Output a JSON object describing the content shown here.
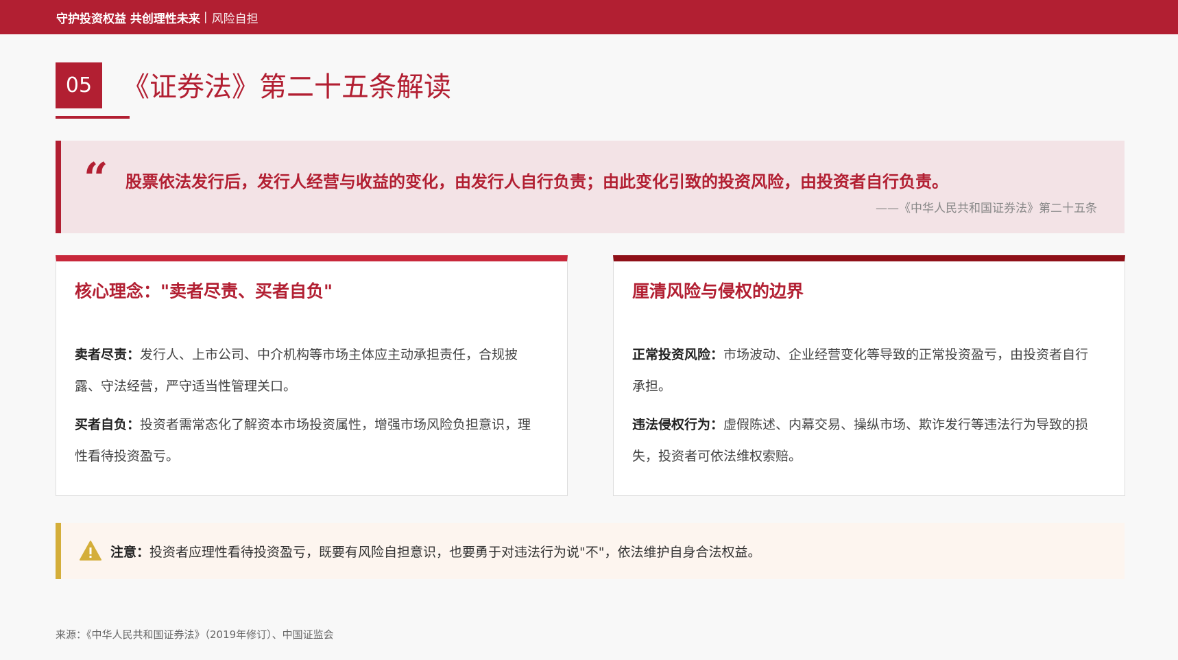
{
  "header": {
    "title": "守护投资权益 共创理性未来",
    "separator": "|",
    "subtitle": "风险自担"
  },
  "section": {
    "number": "05",
    "title": "《证券法》第二十五条解读"
  },
  "quote": {
    "mark": "“",
    "text": "股票依法发行后，发行人经营与收益的变化，由发行人自行负责；由此变化引致的投资风险，由投资者自行负责。",
    "source": "——《中华人民共和国证券法》第二十五条"
  },
  "cards": {
    "left": {
      "title": "核心理念：\"卖者尽责、买者自负\"",
      "items": [
        {
          "label": "卖者尽责：",
          "text": "发行人、上市公司、中介机构等市场主体应主动承担责任，合规披露、守法经营，严守适当性管理关口。"
        },
        {
          "label": "买者自负：",
          "text": "投资者需常态化了解资本市场投资属性，增强市场风险负担意识，理性看待投资盈亏。"
        }
      ]
    },
    "right": {
      "title": "厘清风险与侵权的边界",
      "items": [
        {
          "label": "正常投资风险：",
          "text": "市场波动、企业经营变化等导致的正常投资盈亏，由投资者自行承担。"
        },
        {
          "label": "违法侵权行为：",
          "text": "虚假陈述、内幕交易、操纵市场、欺诈发行等违法行为导致的损失，投资者可依法维权索赔。"
        }
      ]
    }
  },
  "notice": {
    "icon": "warning-icon",
    "label": "注意：",
    "text": "投资者应理性看待投资盈亏，既要有风险自担意识，也要勇于对违法行为说\"不\"，依法维护自身合法权益。"
  },
  "footer": {
    "source": "来源：《中华人民共和国证券法》（2019年修订）、中国证监会"
  },
  "colors": {
    "brand": "#b21f32",
    "dark_red": "#8f1018",
    "quote_bg": "#f3e3e6",
    "notice_accent": "#d4ae3a",
    "notice_bg": "#fdf5ef"
  }
}
